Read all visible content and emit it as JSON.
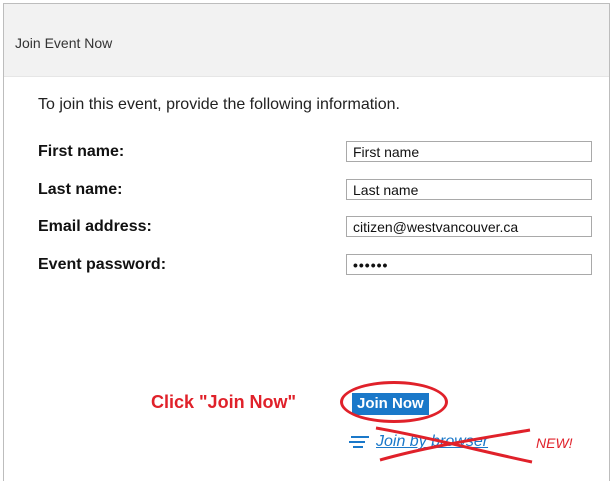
{
  "panel": {
    "title": "Join Event Now"
  },
  "form": {
    "intro": "To join this event, provide the following information.",
    "first_name": {
      "label": "First name:",
      "value": "First name"
    },
    "last_name": {
      "label": "Last name:",
      "value": "Last name"
    },
    "email": {
      "label": "Email address:",
      "value": "citizen@westvancouver.ca"
    },
    "password": {
      "label": "Event password:",
      "value": "••••••"
    }
  },
  "actions": {
    "annotation": "Click \"Join Now\"",
    "join_label": "Join Now",
    "browser_link_label": "Join by browser",
    "new_badge": "NEW!"
  },
  "colors": {
    "accent": "#1a78c9",
    "annotation": "#e0212a",
    "header_bg": "#f2f2f2"
  },
  "icons": {
    "browser_link_icon": "list-icon"
  }
}
